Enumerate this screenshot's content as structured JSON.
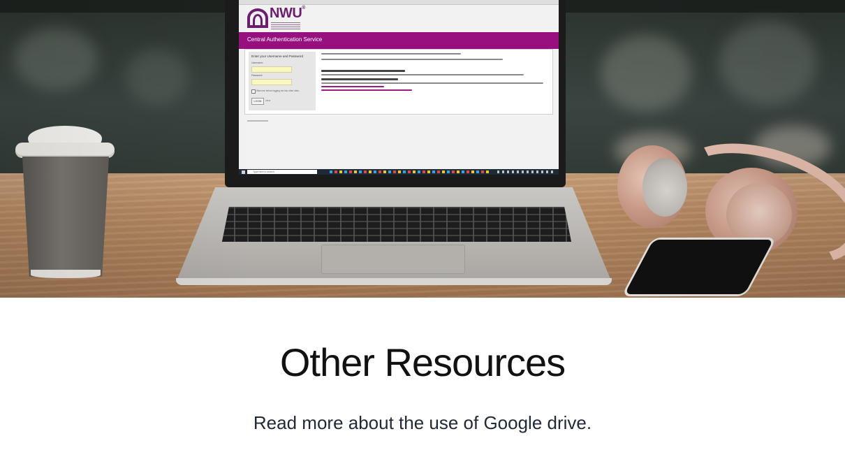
{
  "hero": {
    "image_alt": "Laptop showing NWU Central Authentication Service login page on a wooden desk with coffee cup, headphones and phone",
    "screen": {
      "logo_text": "NWU",
      "logo_reg": "®",
      "cas_title": "Central Authentication Service",
      "login_heading": "Enter your Username and Password",
      "username_label": "Username:",
      "password_label": "Password:",
      "warn_label": "Warn me before logging me into other sites.",
      "login_button": "LOGIN",
      "clear_link": "clear",
      "taskbar_search": "Type here to search"
    }
  },
  "resources": {
    "title": "Other Resources",
    "link_text": "Read more about the use of Google drive."
  },
  "colors": {
    "nwu_purple": "#6c1d6e",
    "cas_bar": "#96117f",
    "title_text": "#111111",
    "link_text": "#1f2937"
  }
}
